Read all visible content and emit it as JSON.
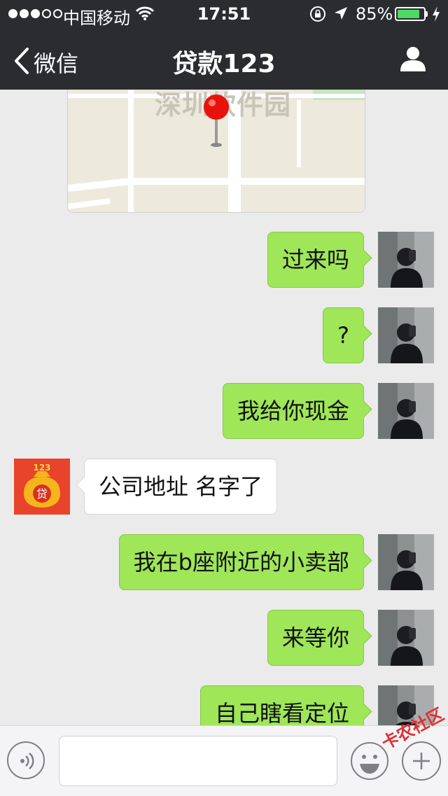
{
  "status_bar": {
    "carrier": "中国移动",
    "time": "17:51",
    "battery_percent": "85%",
    "battery_level": 0.85,
    "signal_bars": 3,
    "signal_total": 5,
    "colors": {
      "battery": "#4cd964"
    }
  },
  "nav": {
    "back_label": "微信",
    "title": "贷款123"
  },
  "map": {
    "label": "深圳软件园"
  },
  "messages": [
    {
      "side": "out",
      "text": "过来吗"
    },
    {
      "side": "out",
      "text": "?"
    },
    {
      "side": "out",
      "text": "我给你现金"
    },
    {
      "side": "in",
      "text": "公司地址 名字了"
    },
    {
      "side": "out",
      "text": "我在b座附近的小卖部"
    },
    {
      "side": "out",
      "text": "来等你"
    },
    {
      "side": "out",
      "text": "自己瞎看定位"
    }
  ],
  "contact_avatar": {
    "badge_text": "123",
    "center_char": "贷"
  },
  "input_bar": {
    "placeholder": ""
  },
  "watermark": "卡农社区",
  "colors": {
    "nav_bg": "#2b2c30",
    "chat_bg": "#ebebeb",
    "outgoing_bubble": "#9fe658",
    "incoming_bubble": "#ffffff",
    "map_pin": "#e8120c"
  },
  "icons": [
    "chevron-left-icon",
    "person-icon",
    "wifi-icon",
    "location-arrow-icon",
    "rotation-lock-icon",
    "charging-bolt-icon",
    "voice-icon",
    "emoji-icon",
    "plus-icon",
    "map-pin-icon"
  ]
}
